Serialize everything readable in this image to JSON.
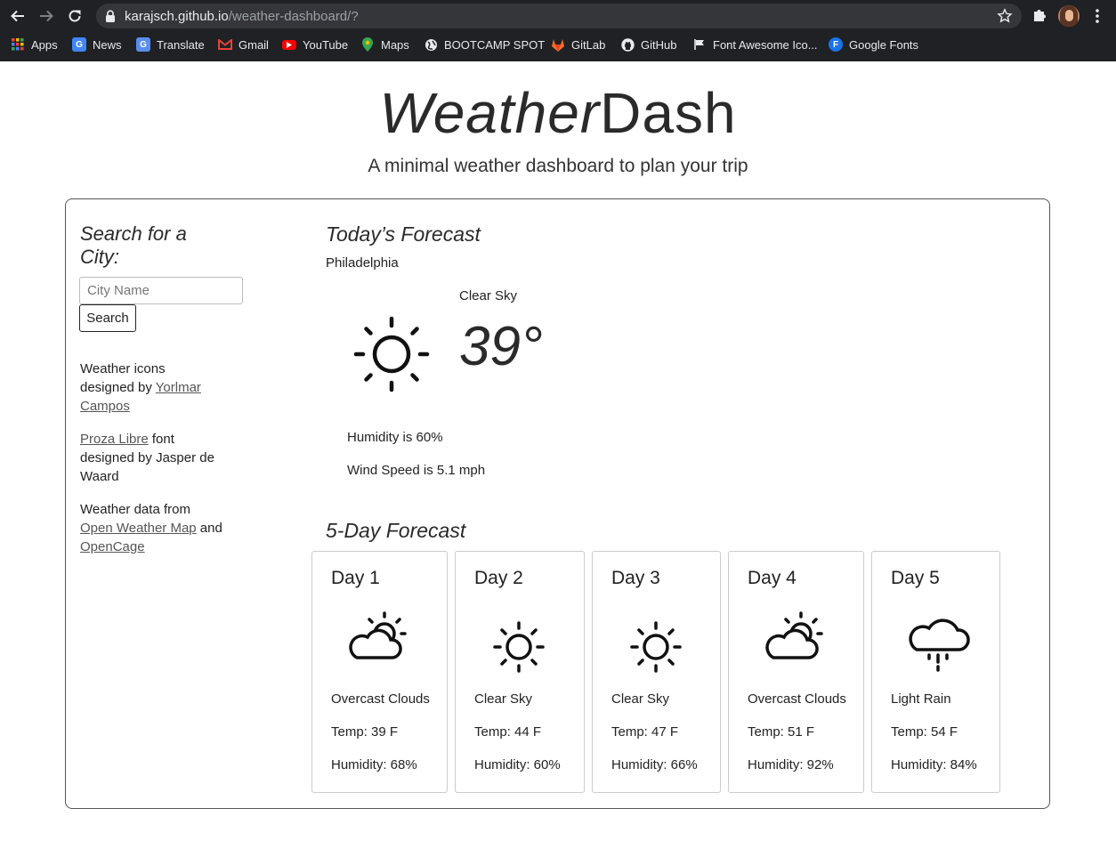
{
  "browser": {
    "url_host": "karajsch.github.io",
    "url_path": "/weather-dashboard/?",
    "bookmarks": [
      {
        "label": "Apps",
        "icon": "apps-grid-icon"
      },
      {
        "label": "News",
        "icon": "google-news-icon"
      },
      {
        "label": "Translate",
        "icon": "google-translate-icon"
      },
      {
        "label": "Gmail",
        "icon": "gmail-icon"
      },
      {
        "label": "YouTube",
        "icon": "youtube-icon"
      },
      {
        "label": "Maps",
        "icon": "google-maps-icon"
      },
      {
        "label": "BOOTCAMP SPOT",
        "icon": "globe-icon"
      },
      {
        "label": "GitLab",
        "icon": "gitlab-icon"
      },
      {
        "label": "GitHub",
        "icon": "github-icon"
      },
      {
        "label": "Font Awesome Ico...",
        "icon": "flag-icon"
      },
      {
        "label": "Google Fonts",
        "icon": "google-fonts-icon"
      }
    ]
  },
  "header": {
    "title_italic": "Weather",
    "title_regular": "Dash",
    "subtitle": "A minimal weather dashboard to plan your trip"
  },
  "search": {
    "heading": "Search for a City:",
    "placeholder": "City Name",
    "value": "",
    "button_label": "Search"
  },
  "credits": {
    "icons_prefix": "Weather icons designed by ",
    "icons_link": "Yorlmar Campos",
    "font_link": "Proza Libre",
    "font_suffix": " font designed by Jasper de Waard",
    "data_prefix": "Weather data from ",
    "data_link1": "Open Weather Map",
    "data_and": " and ",
    "data_link2": "OpenCage"
  },
  "today": {
    "heading": "Today’s Forecast",
    "city": "Philadelphia",
    "description": "Clear Sky",
    "temperature": "39°",
    "icon": "sun-icon",
    "humidity": "Humidity is 60%",
    "wind": "Wind Speed is 5.1 mph"
  },
  "forecast": {
    "heading": "5-Day Forecast",
    "days": [
      {
        "title": "Day 1",
        "icon": "partly-cloudy-icon",
        "description": "Overcast Clouds",
        "temp": "Temp: 39 F",
        "humidity": "Humidity: 68%"
      },
      {
        "title": "Day 2",
        "icon": "sun-icon",
        "description": "Clear Sky",
        "temp": "Temp: 44 F",
        "humidity": "Humidity: 60%"
      },
      {
        "title": "Day 3",
        "icon": "sun-icon",
        "description": "Clear Sky",
        "temp": "Temp: 47 F",
        "humidity": "Humidity: 66%"
      },
      {
        "title": "Day 4",
        "icon": "partly-cloudy-icon",
        "description": "Overcast Clouds",
        "temp": "Temp: 51 F",
        "humidity": "Humidity: 92%"
      },
      {
        "title": "Day 5",
        "icon": "rain-cloud-icon",
        "description": "Light Rain",
        "temp": "Temp: 54 F",
        "humidity": "Humidity: 84%"
      }
    ]
  }
}
